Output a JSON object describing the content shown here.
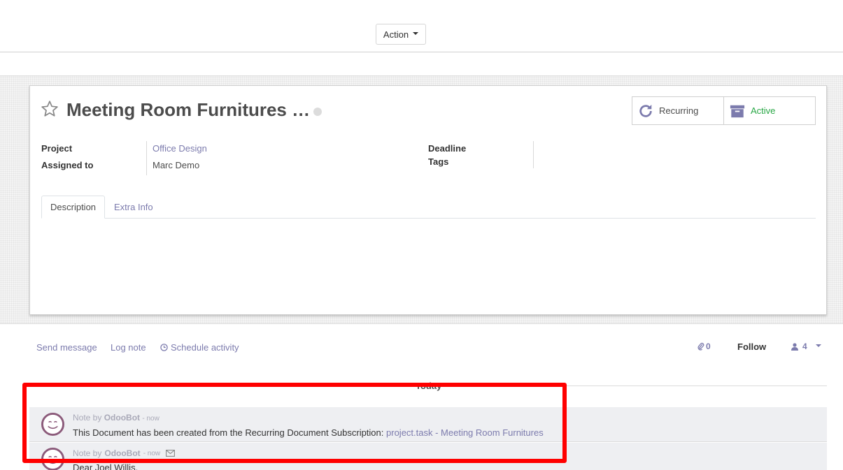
{
  "control_panel": {
    "action_label": "Action"
  },
  "record": {
    "title": "Meeting Room Furnitures …",
    "buttons": {
      "recurring_label": "Recurring",
      "active_label": "Active"
    },
    "fields": {
      "project_label": "Project",
      "project_value": "Office Design",
      "assigned_label": "Assigned to",
      "assigned_value": "Marc Demo",
      "deadline_label": "Deadline",
      "tags_label": "Tags"
    },
    "tabs": [
      {
        "label": "Description"
      },
      {
        "label": "Extra Info"
      }
    ]
  },
  "chatter": {
    "send_message": "Send message",
    "log_note": "Log note",
    "schedule_activity": "Schedule activity",
    "attachments_count": "0",
    "follow_label": "Follow",
    "followers_count": "4",
    "date_separator": "Today",
    "messages": [
      {
        "prefix": "Note by",
        "author": "OdooBot",
        "date": "- now",
        "body_text": "This Document has been created from the Recurring Document Subscription:",
        "body_link": "project.task - Meeting Room Furnitures"
      },
      {
        "prefix": "Note by",
        "author": "OdooBot",
        "date": "- now",
        "body_text": "Dear Joel Willis,"
      }
    ]
  },
  "colors": {
    "accent": "#7c7bad",
    "active_green": "#28a745",
    "highlight_red": "#ff0000"
  }
}
